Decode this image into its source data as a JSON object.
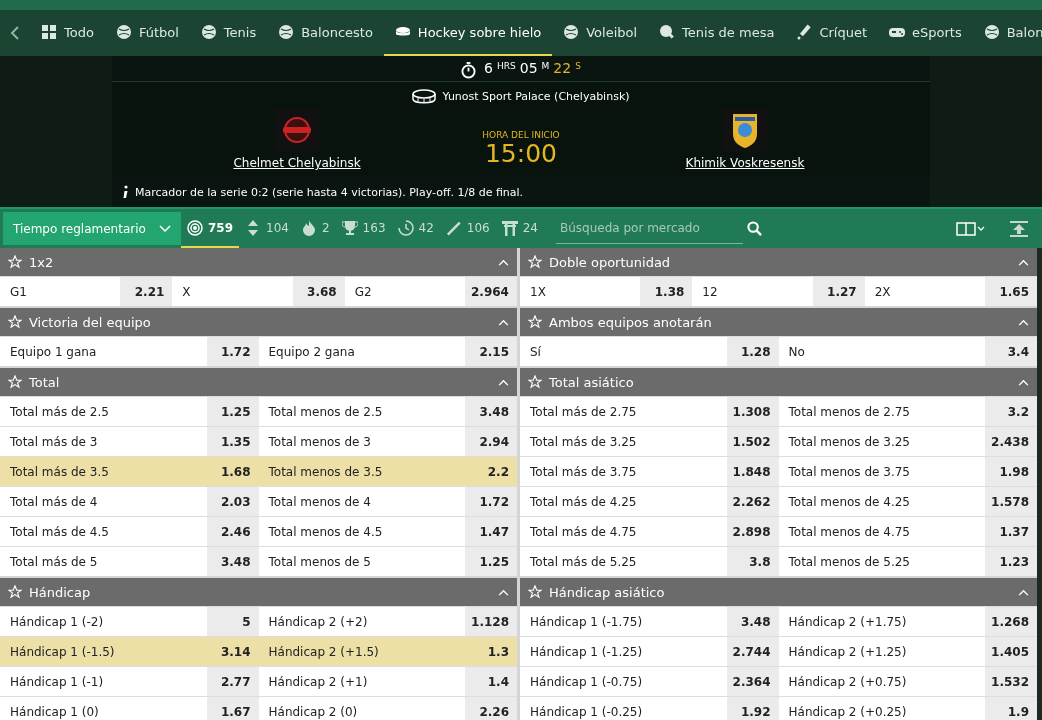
{
  "sports_tabs": [
    {
      "label": "Todo",
      "selected": false
    },
    {
      "label": "Fútbol",
      "selected": false
    },
    {
      "label": "Tenis",
      "selected": false
    },
    {
      "label": "Baloncesto",
      "selected": false
    },
    {
      "label": "Hockey sobre hielo",
      "selected": true
    },
    {
      "label": "Voleibol",
      "selected": false
    },
    {
      "label": "Tenis de mesa",
      "selected": false
    },
    {
      "label": "Críquet",
      "selected": false
    },
    {
      "label": "eSports",
      "selected": false
    },
    {
      "label": "Balon",
      "selected": false
    }
  ],
  "countdown": {
    "hours": "6",
    "hours_unit": "HRS",
    "minutes": "05",
    "minutes_unit": "M",
    "seconds": "22",
    "seconds_unit": "S"
  },
  "match": {
    "venue": "Yunost Sport Palace (Chelyabinsk)",
    "home_team": "Chelmet Chelyabinsk",
    "away_team": "Khimik Voskresensk",
    "start_label": "HORA DEL INICIO",
    "start_time": "15:00",
    "info": "Marcador de la serie 0:2 (serie hasta 4 victorias). Play-off. 1/8 de final."
  },
  "toolbar": {
    "period_select": "Tiempo reglamentario",
    "search_placeholder": "Búsqueda por mercado",
    "filters": [
      {
        "count": "759",
        "selected": true
      },
      {
        "count": "104",
        "selected": false
      },
      {
        "count": "2",
        "selected": false
      },
      {
        "count": "163",
        "selected": false
      },
      {
        "count": "42",
        "selected": false
      },
      {
        "count": "106",
        "selected": false
      },
      {
        "count": "24",
        "selected": false
      }
    ]
  },
  "markets": [
    [
      {
        "title": "1x2",
        "expanded": true,
        "rows": [
          [
            {
              "label": "G1",
              "odd": "2.21",
              "selected": false
            },
            {
              "label": "X",
              "odd": "3.68",
              "selected": false
            },
            {
              "label": "G2",
              "odd": "2.964",
              "selected": false
            }
          ]
        ]
      },
      {
        "title": "Doble oportunidad",
        "expanded": true,
        "rows": [
          [
            {
              "label": "1X",
              "odd": "1.38",
              "selected": false
            },
            {
              "label": "12",
              "odd": "1.27",
              "selected": false
            },
            {
              "label": "2X",
              "odd": "1.65",
              "selected": false
            }
          ]
        ]
      }
    ],
    [
      {
        "title": "Victoria del equipo",
        "expanded": true,
        "rows": [
          [
            {
              "label": "Equipo 1 gana",
              "odd": "1.72",
              "selected": false
            },
            {
              "label": "Equipo 2 gana",
              "odd": "2.15",
              "selected": false
            }
          ]
        ]
      },
      {
        "title": "Ambos equipos anotarán",
        "expanded": true,
        "rows": [
          [
            {
              "label": "Sí",
              "odd": "1.28",
              "selected": false
            },
            {
              "label": "No",
              "odd": "3.4",
              "selected": false
            }
          ]
        ]
      }
    ],
    [
      {
        "title": "Total",
        "expanded": true,
        "rows": [
          [
            {
              "label": "Total más de 2.5",
              "odd": "1.25",
              "selected": false
            },
            {
              "label": "Total menos de 2.5",
              "odd": "3.48",
              "selected": false
            }
          ],
          [
            {
              "label": "Total más de 3",
              "odd": "1.35",
              "selected": false
            },
            {
              "label": "Total menos de 3",
              "odd": "2.94",
              "selected": false
            }
          ],
          [
            {
              "label": "Total más de 3.5",
              "odd": "1.68",
              "selected": true
            },
            {
              "label": "Total menos de 3.5",
              "odd": "2.2",
              "selected": true
            }
          ],
          [
            {
              "label": "Total más de 4",
              "odd": "2.03",
              "selected": false
            },
            {
              "label": "Total menos de 4",
              "odd": "1.72",
              "selected": false
            }
          ],
          [
            {
              "label": "Total más de 4.5",
              "odd": "2.46",
              "selected": false
            },
            {
              "label": "Total menos de 4.5",
              "odd": "1.47",
              "selected": false
            }
          ],
          [
            {
              "label": "Total más de 5",
              "odd": "3.48",
              "selected": false
            },
            {
              "label": "Total menos de 5",
              "odd": "1.25",
              "selected": false
            }
          ]
        ]
      },
      {
        "title": "Total asiático",
        "expanded": true,
        "rows": [
          [
            {
              "label": "Total más de 2.75",
              "odd": "1.308",
              "selected": false
            },
            {
              "label": "Total menos de 2.75",
              "odd": "3.2",
              "selected": false
            }
          ],
          [
            {
              "label": "Total más de 3.25",
              "odd": "1.502",
              "selected": false
            },
            {
              "label": "Total menos de 3.25",
              "odd": "2.438",
              "selected": false
            }
          ],
          [
            {
              "label": "Total más de 3.75",
              "odd": "1.848",
              "selected": false
            },
            {
              "label": "Total menos de 3.75",
              "odd": "1.98",
              "selected": false
            }
          ],
          [
            {
              "label": "Total más de 4.25",
              "odd": "2.262",
              "selected": false
            },
            {
              "label": "Total menos de 4.25",
              "odd": "1.578",
              "selected": false
            }
          ],
          [
            {
              "label": "Total más de 4.75",
              "odd": "2.898",
              "selected": false
            },
            {
              "label": "Total menos de 4.75",
              "odd": "1.37",
              "selected": false
            }
          ],
          [
            {
              "label": "Total más de 5.25",
              "odd": "3.8",
              "selected": false
            },
            {
              "label": "Total menos de 5.25",
              "odd": "1.23",
              "selected": false
            }
          ]
        ]
      }
    ],
    [
      {
        "title": "Hándicap",
        "expanded": true,
        "rows": [
          [
            {
              "label": "Hándicap 1 (-2)",
              "odd": "5",
              "selected": false
            },
            {
              "label": "Hándicap 2 (+2)",
              "odd": "1.128",
              "selected": false
            }
          ],
          [
            {
              "label": "Hándicap 1 (-1.5)",
              "odd": "3.14",
              "selected": true
            },
            {
              "label": "Hándicap 2 (+1.5)",
              "odd": "1.3",
              "selected": true
            }
          ],
          [
            {
              "label": "Hándicap 1 (-1)",
              "odd": "2.77",
              "selected": false
            },
            {
              "label": "Hándicap 2 (+1)",
              "odd": "1.4",
              "selected": false
            }
          ],
          [
            {
              "label": "Hándicap 1 (0)",
              "odd": "1.67",
              "selected": false
            },
            {
              "label": "Hándicap 2 (0)",
              "odd": "2.26",
              "selected": false
            }
          ]
        ]
      },
      {
        "title": "Hándicap asiático",
        "expanded": true,
        "rows": [
          [
            {
              "label": "Hándicap 1 (-1.75)",
              "odd": "3.48",
              "selected": false
            },
            {
              "label": "Hándicap 2 (+1.75)",
              "odd": "1.268",
              "selected": false
            }
          ],
          [
            {
              "label": "Hándicap 1 (-1.25)",
              "odd": "2.744",
              "selected": false
            },
            {
              "label": "Hándicap 2 (+1.25)",
              "odd": "1.405",
              "selected": false
            }
          ],
          [
            {
              "label": "Hándicap 1 (-0.75)",
              "odd": "2.364",
              "selected": false
            },
            {
              "label": "Hándicap 2 (+0.75)",
              "odd": "1.532",
              "selected": false
            }
          ],
          [
            {
              "label": "Hándicap 1 (-0.25)",
              "odd": "1.92",
              "selected": false
            },
            {
              "label": "Hándicap 2 (+0.25)",
              "odd": "1.9",
              "selected": false
            }
          ]
        ]
      }
    ]
  ]
}
